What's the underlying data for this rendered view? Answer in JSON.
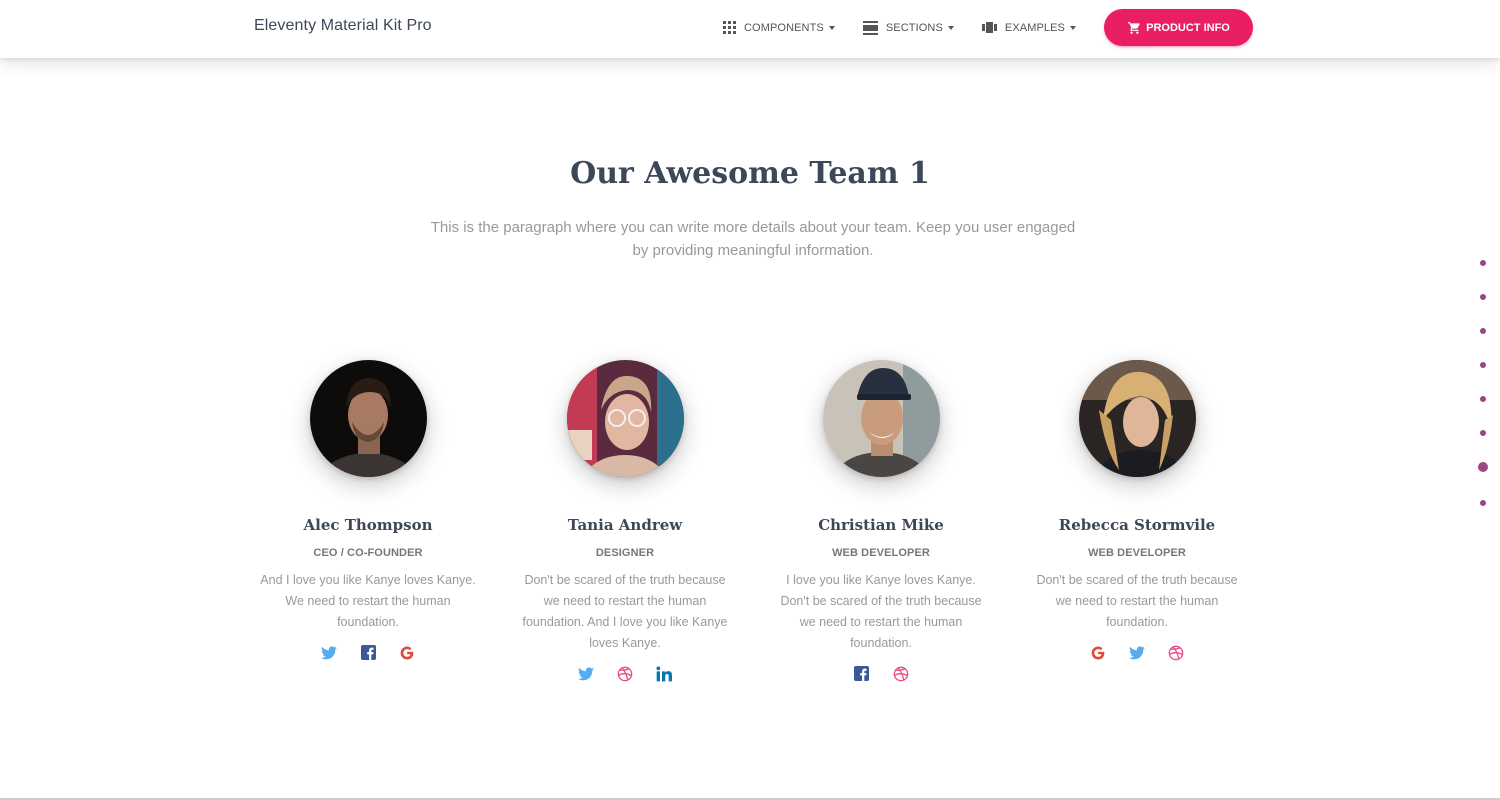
{
  "navbar": {
    "brand": "Eleventy Material Kit Pro",
    "items": [
      {
        "label": "COMPONENTS",
        "icon": "apps-grid-icon"
      },
      {
        "label": "SECTIONS",
        "icon": "view-day-icon"
      },
      {
        "label": "EXAMPLES",
        "icon": "view-carousel-icon"
      }
    ],
    "cta": {
      "label": "PRODUCT INFO",
      "icon": "shopping-cart-icon",
      "color": "#e91e63"
    }
  },
  "section": {
    "title": "Our Awesome Team 1",
    "description": "This is the paragraph where you can write more details about your team. Keep you user engaged by providing meaningful information."
  },
  "team": [
    {
      "name": "Alec Thompson",
      "role": "CEO / CO-FOUNDER",
      "description": "And I love you like Kanye loves Kanye. We need to restart the human foundation.",
      "socials": [
        "twitter-icon",
        "facebook-icon",
        "google-icon"
      ]
    },
    {
      "name": "Tania Andrew",
      "role": "DESIGNER",
      "description": "Don't be scared of the truth because we need to restart the human foundation. And I love you like Kanye loves Kanye.",
      "socials": [
        "twitter-icon",
        "dribbble-icon",
        "linkedin-icon"
      ]
    },
    {
      "name": "Christian Mike",
      "role": "WEB DEVELOPER",
      "description": "I love you like Kanye loves Kanye. Don't be scared of the truth because we need to restart the human foundation.",
      "socials": [
        "facebook-icon",
        "dribbble-icon"
      ]
    },
    {
      "name": "Rebecca Stormvile",
      "role": "WEB DEVELOPER",
      "description": "Don't be scared of the truth because we need to restart the human foundation.",
      "socials": [
        "google-icon",
        "twitter-icon",
        "dribbble-icon"
      ]
    }
  ],
  "section_nav": {
    "dot_count": 8,
    "active_index": 6,
    "color": "#9c4683"
  },
  "colors": {
    "text_dark": "#3c4858",
    "text_muted": "#999999",
    "twitter": "#55acee",
    "facebook": "#3b5998",
    "google": "#dd4b39",
    "dribbble": "#ea4c89",
    "linkedin": "#0976b4"
  }
}
